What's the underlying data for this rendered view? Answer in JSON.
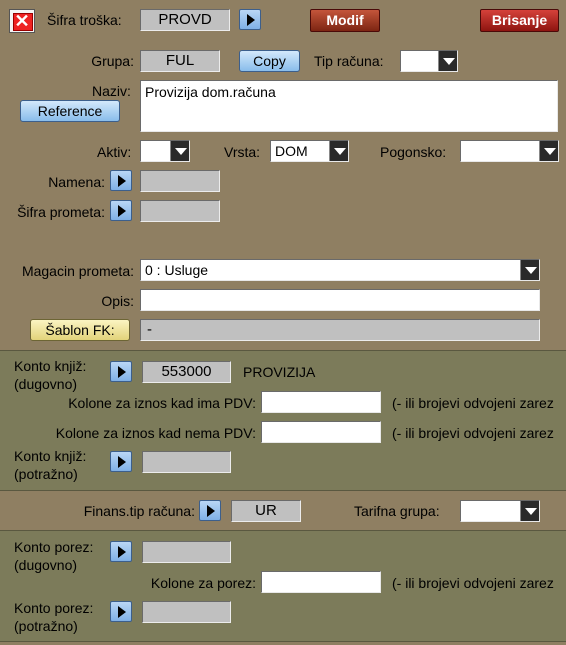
{
  "header": {
    "close_icon": "close-icon",
    "sifra_troska_label": "Šifra troška:",
    "sifra_troska_value": "PROVD",
    "modif_label": "Modif",
    "brisanje_label": "Brisanje"
  },
  "form": {
    "grupa_label": "Grupa:",
    "grupa_value": "FUL",
    "copy_label": "Copy",
    "tip_racuna_label": "Tip računa:",
    "tip_racuna_value": "",
    "naziv_label": "Naziv:",
    "naziv_value": "Provizija dom.računa",
    "reference_label": "Reference",
    "aktiv_label": "Aktiv:",
    "aktiv_value": "",
    "vrsta_label": "Vrsta:",
    "vrsta_value": "DOM",
    "pogonsko_label": "Pogonsko:",
    "pogonsko_value": "",
    "namena_label": "Namena:",
    "namena_value": "",
    "sifra_prometa_label": "Šifra prometa:",
    "sifra_prometa_value": "",
    "magacin_label": "Magacin prometa:",
    "magacin_value": "0 : Usluge",
    "opis_label": "Opis:",
    "opis_value": "",
    "sablon_label": "Šablon FK:",
    "sablon_value": "-"
  },
  "konto_panel": {
    "konto_dug_label1": "Konto knjiž:",
    "konto_dug_label2": "(dugovno)",
    "konto_dug_value": "553000",
    "konto_dug_name": "PROVIZIJA",
    "kolone_ima_label": "Kolone za iznos kad ima PDV:",
    "kolone_ima_value": "",
    "kolone_ima_hint": "(- ili brojevi odvojeni zarez",
    "kolone_nema_label": "Kolone za iznos kad nema PDV:",
    "kolone_nema_value": "",
    "kolone_nema_hint": "(- ili brojevi odvojeni zarez",
    "konto_pot_label1": "Konto knjiž:",
    "konto_pot_label2": "(potražno)",
    "konto_pot_value": ""
  },
  "finans": {
    "finans_label": "Finans.tip računa:",
    "finans_value": "UR",
    "tarifna_label": "Tarifna grupa:",
    "tarifna_value": ""
  },
  "porez_panel": {
    "porez_dug_label1": "Konto porez:",
    "porez_dug_label2": "(dugovno)",
    "porez_dug_value": "",
    "kolone_porez_label": "Kolone za porez:",
    "kolone_porez_value": "",
    "kolone_porez_hint": "(- ili brojevi odvojeni zarez",
    "porez_pot_label1": "Konto porez:",
    "porez_pot_label2": "(potražno)",
    "porez_pot_value": ""
  },
  "colors": {
    "background": "#8f7f62",
    "panel": "#7c7b5a",
    "delete_button": "#b01e18",
    "modif_button": "#a4331f"
  }
}
